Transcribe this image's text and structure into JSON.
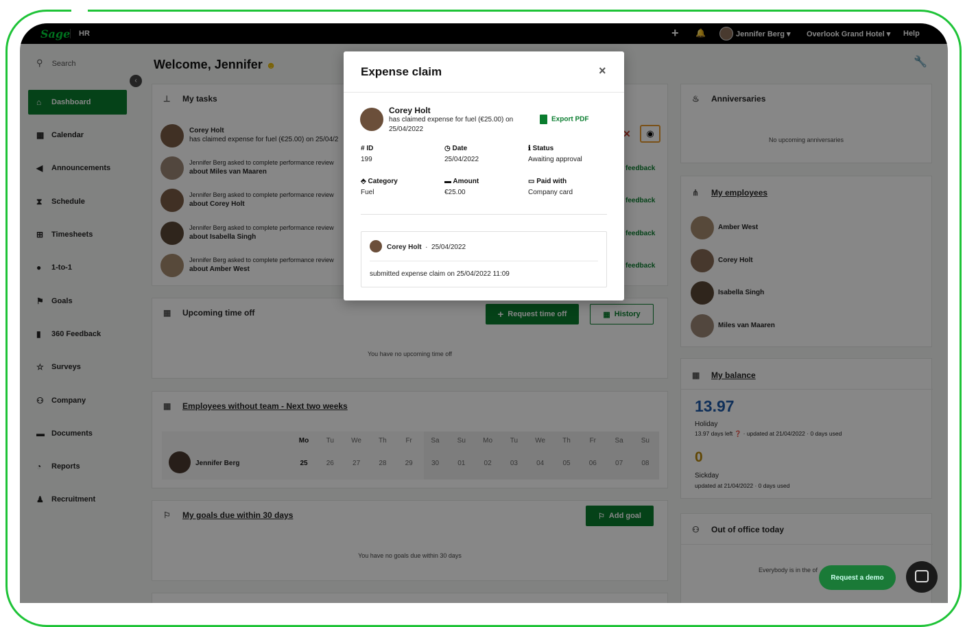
{
  "topbar": {
    "brand": "Sage",
    "module": "HR",
    "add_icon": "plus",
    "notifications_icon": "bell",
    "user": "Jennifer Berg ▾",
    "org": "Overlook Grand Hotel ▾",
    "help": "Help"
  },
  "sidebar": {
    "search_placeholder": "Search",
    "items": [
      {
        "label": "Dashboard",
        "icon": "home"
      },
      {
        "label": "Calendar",
        "icon": "calendar"
      },
      {
        "label": "Announcements",
        "icon": "megaphone"
      },
      {
        "label": "Schedule",
        "icon": "hourglass"
      },
      {
        "label": "Timesheets",
        "icon": "table"
      },
      {
        "label": "1-to-1",
        "icon": "chat"
      },
      {
        "label": "Goals",
        "icon": "flag"
      },
      {
        "label": "360 Feedback",
        "icon": "book"
      },
      {
        "label": "Surveys",
        "icon": "star"
      },
      {
        "label": "Company",
        "icon": "users"
      },
      {
        "label": "Documents",
        "icon": "folder"
      },
      {
        "label": "Reports",
        "icon": "pie"
      },
      {
        "label": "Recruitment",
        "icon": "user-plus"
      }
    ]
  },
  "main": {
    "welcome": "Welcome, Jennifer",
    "tasks": {
      "title": "My tasks",
      "items": [
        {
          "l1": "Corey Holt",
          "l2": "has claimed expense for fuel (€25.00) on 25/04/2"
        },
        {
          "l1": "Jennifer Berg asked to complete performance review",
          "l2": "about Miles van Maaren",
          "action": "feedback"
        },
        {
          "l1": "Jennifer Berg asked to complete performance review",
          "l2": "about Corey Holt",
          "action": "feedback"
        },
        {
          "l1": "Jennifer Berg asked to complete performance review",
          "l2": "about Isabella Singh",
          "action": "feedback"
        },
        {
          "l1": "Jennifer Berg asked to complete performance review",
          "l2": "about Amber West",
          "action": "feedback"
        }
      ]
    },
    "timeoff": {
      "title": "Upcoming time off",
      "request_label": "Request time off",
      "history_label": "History",
      "empty": "You have no upcoming time off"
    },
    "without_team": {
      "title": "Employees without team - Next two weeks",
      "days": [
        "Mo",
        "Tu",
        "We",
        "Th",
        "Fr",
        "Sa",
        "Su",
        "Mo",
        "Tu",
        "We",
        "Th",
        "Fr",
        "Sa",
        "Su"
      ],
      "dates": [
        "25",
        "26",
        "27",
        "28",
        "29",
        "30",
        "01",
        "02",
        "03",
        "04",
        "05",
        "06",
        "07",
        "08"
      ],
      "employee": "Jennifer Berg"
    },
    "goals": {
      "title": "My goals due within 30 days",
      "add_label": "Add goal",
      "empty": "You have no goals due within 30 days"
    }
  },
  "right": {
    "anniversaries": {
      "title": "Anniversaries",
      "empty": "No upcoming anniversaries"
    },
    "employees": {
      "title": "My employees",
      "items": [
        "Amber West",
        "Corey Holt",
        "Isabella Singh",
        "Miles van Maaren"
      ]
    },
    "balance": {
      "title": "My balance",
      "holiday_value": "13.97",
      "holiday_label": "Holiday",
      "holiday_detail": "13.97 days left",
      "holiday_updated": "· updated at 21/04/2022 · 0 days used",
      "sick_value": "0",
      "sick_label": "Sickday",
      "sick_detail": "updated at 21/04/2022 · 0 days used"
    },
    "out_of_office": {
      "title": "Out of office today",
      "text": "Everybody is in the of"
    }
  },
  "modal": {
    "title": "Expense claim",
    "close": "×",
    "name": "Corey Holt",
    "desc": "has claimed expense for fuel (€25.00) on 25/04/2022",
    "export": "Export PDF",
    "fields": {
      "id_label": "# ID",
      "id_value": "199",
      "date_label": "Date",
      "date_value": "25/04/2022",
      "status_label": "Status",
      "status_value": "Awaiting approval",
      "category_label": "Category",
      "category_value": "Fuel",
      "amount_label": "Amount",
      "amount_value": "€25.00",
      "paid_label": "Paid with",
      "paid_value": "Company card"
    },
    "history": {
      "name": "Corey Holt",
      "date": "25/04/2022",
      "text": "submitted expense claim on 25/04/2022 11:09"
    }
  },
  "chat": {
    "request_demo": "Request a demo"
  },
  "colors": {
    "accent": "#0a7d2f",
    "frame": "#1ec337",
    "balance": "#1e5aa8",
    "sick": "#b8860b"
  }
}
